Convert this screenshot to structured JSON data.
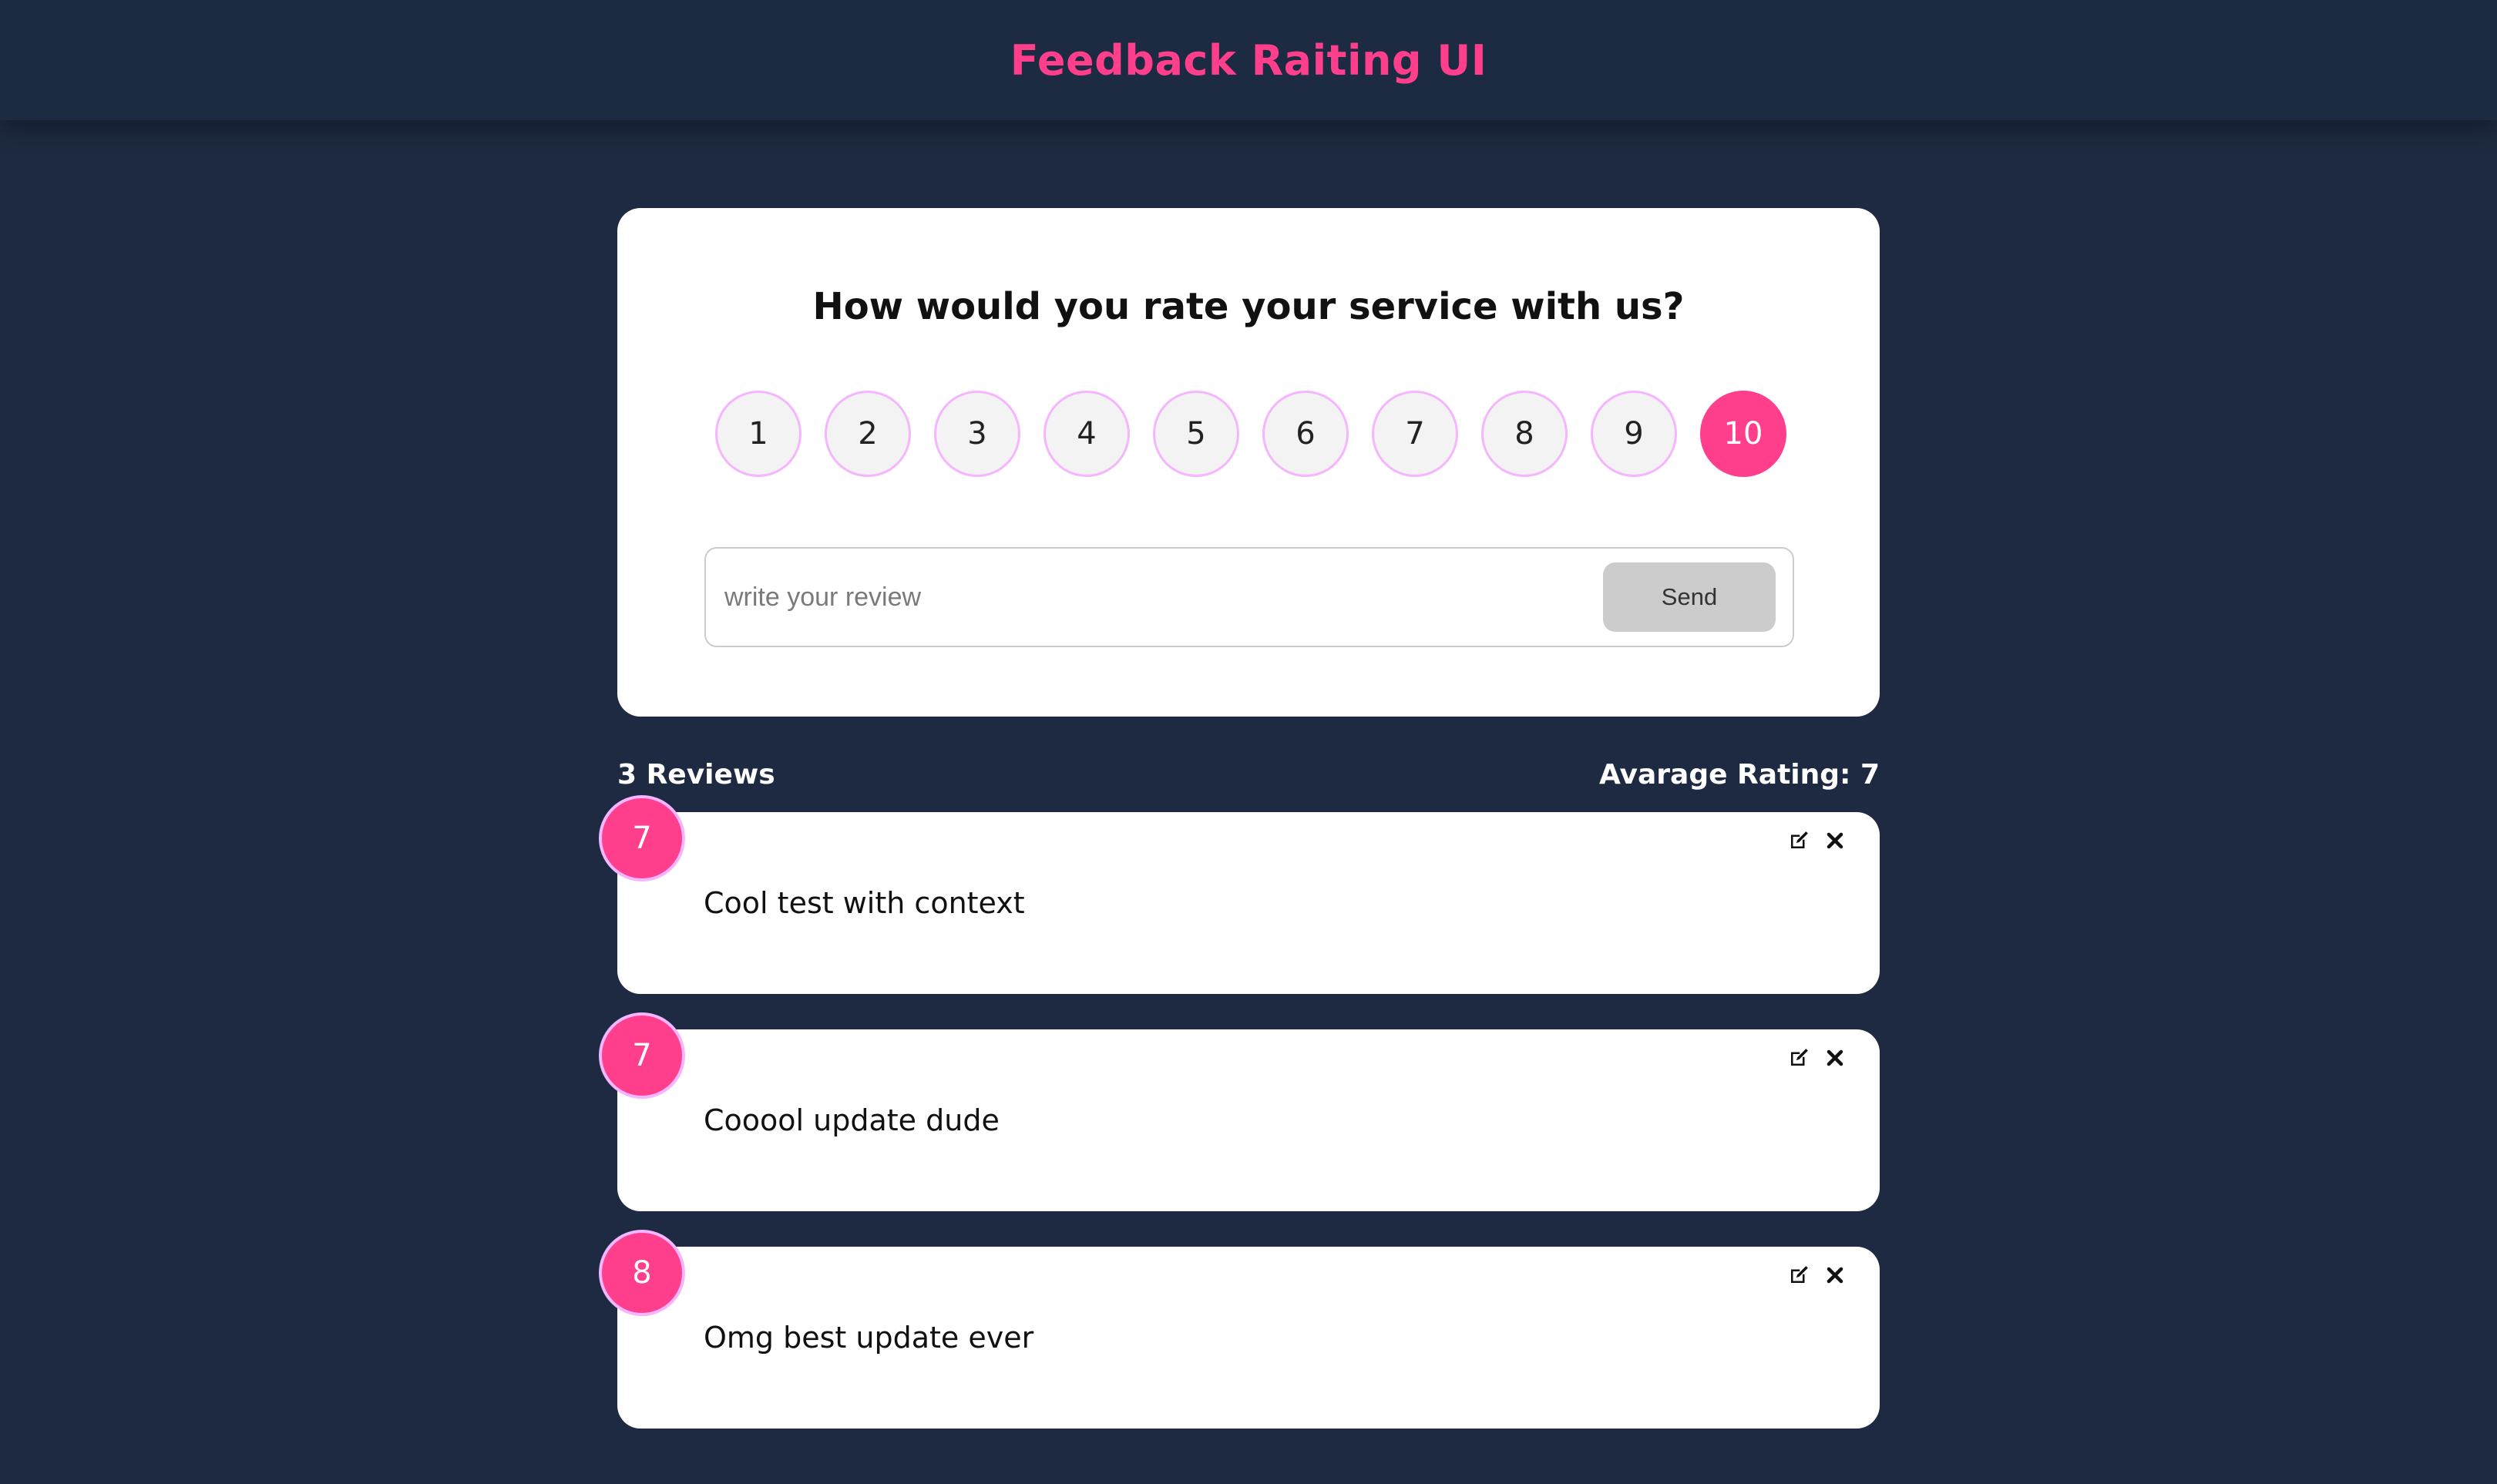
{
  "header": {
    "title": "Feedback Raiting UI"
  },
  "rating_card": {
    "question": "How would you rate your service with us?",
    "options": [
      "1",
      "2",
      "3",
      "4",
      "5",
      "6",
      "7",
      "8",
      "9",
      "10"
    ],
    "selected": "10",
    "input": {
      "placeholder": "write your review",
      "value": ""
    },
    "send_label": "Send"
  },
  "stats": {
    "reviews_count_label": "3 Reviews",
    "average_label": "Avarage Rating: 7"
  },
  "reviews": [
    {
      "rating": "7",
      "text": "Cool test with context"
    },
    {
      "rating": "7",
      "text": "Cooool update dude"
    },
    {
      "rating": "8",
      "text": "Omg best update ever"
    }
  ],
  "icons": {
    "edit": "edit-icon",
    "delete": "close-icon"
  },
  "colors": {
    "background": "#1e2a41",
    "accent": "#ff3f8c",
    "accent_border": "#f6b5ff",
    "card": "#ffffff"
  }
}
